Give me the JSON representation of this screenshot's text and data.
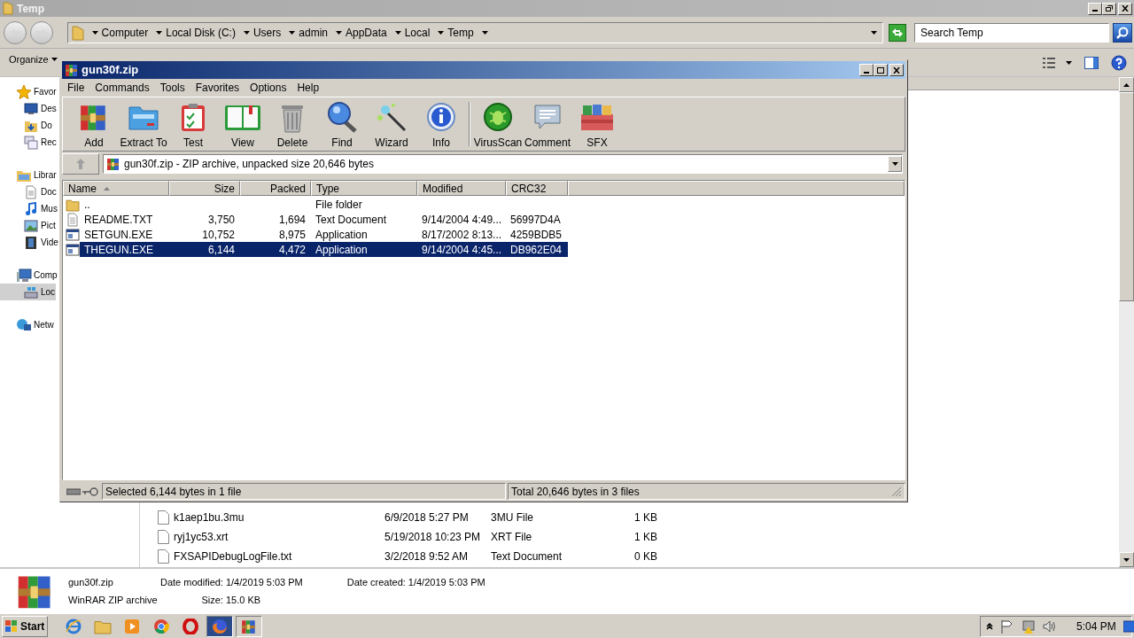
{
  "explorer": {
    "title": "Temp",
    "breadcrumbs": [
      "Computer",
      "Local Disk (C:)",
      "Users",
      "admin",
      "AppData",
      "Local",
      "Temp"
    ],
    "search": {
      "placeholder": "Search Temp"
    },
    "organize": "Organize",
    "nav": [
      {
        "label": "Favor",
        "selected": false,
        "children": [
          {
            "label": "Des",
            "selected": false
          },
          {
            "label": "Do",
            "selected": false
          },
          {
            "label": "Rec",
            "selected": false
          }
        ]
      },
      {
        "label": "Librar",
        "selected": false,
        "children": [
          {
            "label": "Doc",
            "selected": false
          },
          {
            "label": "Mus",
            "selected": false
          },
          {
            "label": "Pict",
            "selected": false
          },
          {
            "label": "Vide",
            "selected": false
          }
        ]
      },
      {
        "label": "Comp",
        "selected": false,
        "children": [
          {
            "label": "Loc",
            "selected": true
          }
        ]
      },
      {
        "label": "Netw",
        "selected": false
      }
    ],
    "files": [
      {
        "name": "k1aep1bu.3mu",
        "modified": "6/9/2018 5:27 PM",
        "type": "3MU File",
        "size": "1 KB"
      },
      {
        "name": "ryj1yc53.xrt",
        "modified": "5/19/2018 10:23 PM",
        "type": "XRT File",
        "size": "1 KB"
      },
      {
        "name": "FXSAPIDebugLogFile.txt",
        "modified": "3/2/2018 9:52 AM",
        "type": "Text Document",
        "size": "0 KB"
      }
    ],
    "details": {
      "name": "gun30f.zip",
      "type": "WinRAR ZIP archive",
      "columns": [
        [
          {
            "label": "Date modified:",
            "value": "1/4/2019 5:03 PM"
          },
          {
            "label": "Size:",
            "value": "15.0 KB"
          }
        ],
        [
          {
            "label": "Date created:",
            "value": "1/4/2019 5:03 PM"
          }
        ]
      ]
    }
  },
  "winrar": {
    "title": "gun30f.zip",
    "menu": [
      "File",
      "Commands",
      "Tools",
      "Favorites",
      "Options",
      "Help"
    ],
    "tool_groups": [
      [
        "Add",
        "Extract To",
        "Test",
        "View",
        "Delete",
        "Find",
        "Wizard",
        "Info"
      ],
      [
        "VirusScan",
        "Comment",
        "SFX"
      ]
    ],
    "path": "gun30f.zip - ZIP archive, unpacked size 20,646 bytes",
    "columns": [
      "Name",
      "Size",
      "Packed",
      "Type",
      "Modified",
      "CRC32"
    ],
    "rows": [
      {
        "kind": "folder",
        "name": "..",
        "type": "File folder",
        "selected": false
      },
      {
        "kind": "text",
        "name": "README.TXT",
        "size": "3,750",
        "packed": "1,694",
        "type": "Text Document",
        "modified": "9/14/2004 4:49...",
        "crc": "56997D4A",
        "selected": false
      },
      {
        "kind": "program",
        "name": "SETGUN.EXE",
        "size": "10,752",
        "packed": "8,975",
        "type": "Application",
        "modified": "8/17/2002 8:13...",
        "crc": "4259BDB5",
        "selected": false
      },
      {
        "kind": "program",
        "name": "THEGUN.EXE",
        "size": "6,144",
        "packed": "4,472",
        "type": "Application",
        "modified": "9/14/2004 4:45...",
        "crc": "DB962E04",
        "selected": true
      }
    ],
    "status": [
      "Selected 6,144 bytes in 1 file",
      "Total 20,646 bytes in 3 files"
    ]
  },
  "taskbar": {
    "start": "Start",
    "clock": "5:04 PM"
  }
}
